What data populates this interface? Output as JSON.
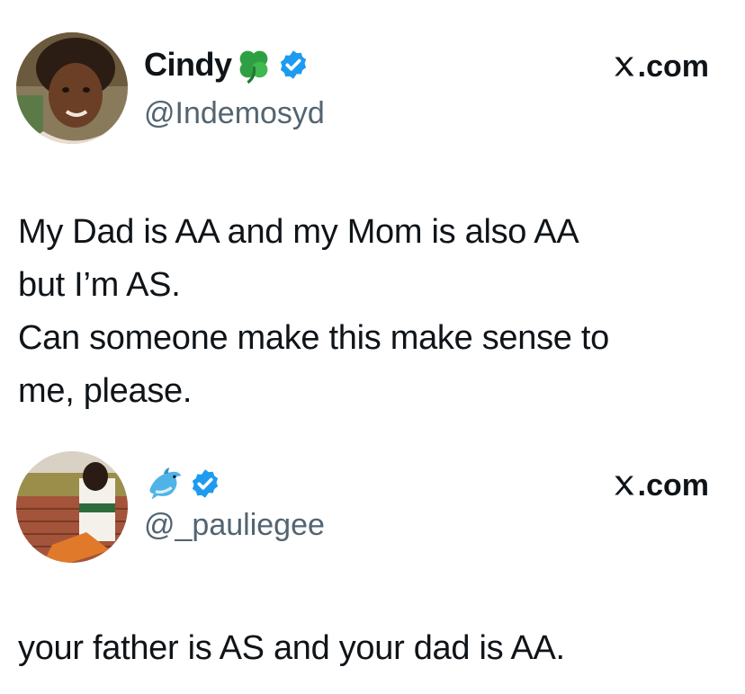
{
  "tweets": [
    {
      "display_name": "Cindy",
      "name_emoji": "shamrock-emoji-icon",
      "verified": true,
      "handle": "@Indemosyd",
      "source_label": ".com",
      "source_logo": "x-logo-icon",
      "text": "My Dad is AA and my Mom is also AA\nbut I’m AS.\nCan someone make this make sense to\nme, please."
    },
    {
      "display_name": "",
      "name_emoji": "dolphin-emoji-icon",
      "verified": true,
      "handle": "@_pauliegee",
      "source_label": ".com",
      "source_logo": "x-logo-icon",
      "text": "your father is AS and your dad is AA."
    }
  ],
  "colors": {
    "text": "#0f1419",
    "secondary": "#536471",
    "verified": "#1d9bf0",
    "shamrock": "#2ea043",
    "dolphin": "#4fb3e8"
  }
}
